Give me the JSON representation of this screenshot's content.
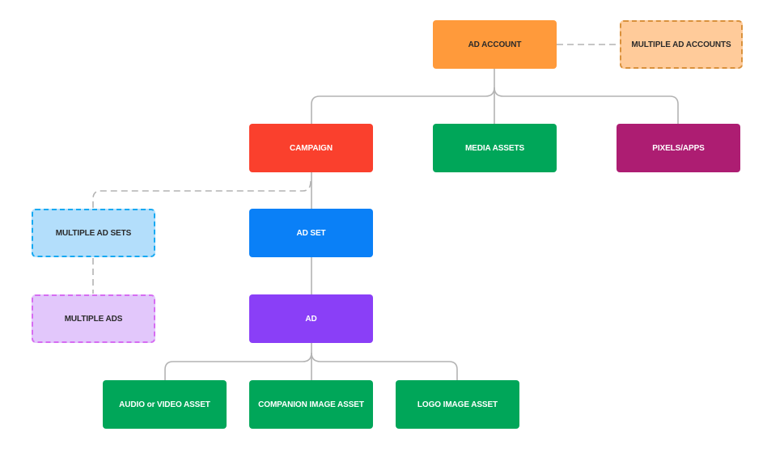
{
  "diagram": {
    "nodes": {
      "ad_account": {
        "label": "AD ACCOUNT",
        "color": "#FF9A3B"
      },
      "multiple_ad_accounts": {
        "label": "MULTIPLE AD ACCOUNTS",
        "color": "#FFCB9A",
        "border": "#D9913C",
        "style": "dashed"
      },
      "campaign": {
        "label": "CAMPAIGN",
        "color": "#FA402D"
      },
      "media_assets": {
        "label": "MEDIA ASSETS",
        "color": "#00A659"
      },
      "pixels_apps": {
        "label": "PIXELS/APPS",
        "color": "#AD1D72"
      },
      "multiple_ad_sets": {
        "label": "MULTIPLE AD SETS",
        "color": "#B3DEFB",
        "border": "#16A9F2",
        "style": "dashed"
      },
      "ad_set": {
        "label": "AD SET",
        "color": "#0A80F7"
      },
      "multiple_ads": {
        "label": "MULTIPLE ADS",
        "color": "#E2C7FB",
        "border": "#D66CF2",
        "style": "dashed"
      },
      "ad": {
        "label": "AD",
        "color": "#8A3FF7"
      },
      "audio_video_asset": {
        "label": "AUDIO or VIDEO ASSET",
        "color": "#00A659"
      },
      "companion_image_asset": {
        "label": "COMPANION IMAGE ASSET",
        "color": "#00A659"
      },
      "logo_image_asset": {
        "label": "LOGO IMAGE ASSET",
        "color": "#00A659"
      }
    },
    "edges": [
      {
        "from": "ad_account",
        "to": "multiple_ad_accounts",
        "style": "dashed"
      },
      {
        "from": "ad_account",
        "to": "campaign",
        "style": "solid"
      },
      {
        "from": "ad_account",
        "to": "media_assets",
        "style": "solid"
      },
      {
        "from": "ad_account",
        "to": "pixels_apps",
        "style": "solid"
      },
      {
        "from": "campaign",
        "to": "ad_set",
        "style": "solid"
      },
      {
        "from": "campaign",
        "to": "multiple_ad_sets",
        "style": "dashed"
      },
      {
        "from": "multiple_ad_sets",
        "to": "multiple_ads",
        "style": "dashed"
      },
      {
        "from": "ad_set",
        "to": "ad",
        "style": "solid"
      },
      {
        "from": "ad",
        "to": "audio_video_asset",
        "style": "solid"
      },
      {
        "from": "ad",
        "to": "companion_image_asset",
        "style": "solid"
      },
      {
        "from": "ad",
        "to": "logo_image_asset",
        "style": "solid"
      }
    ],
    "connector_color": "#B3B3B3"
  }
}
